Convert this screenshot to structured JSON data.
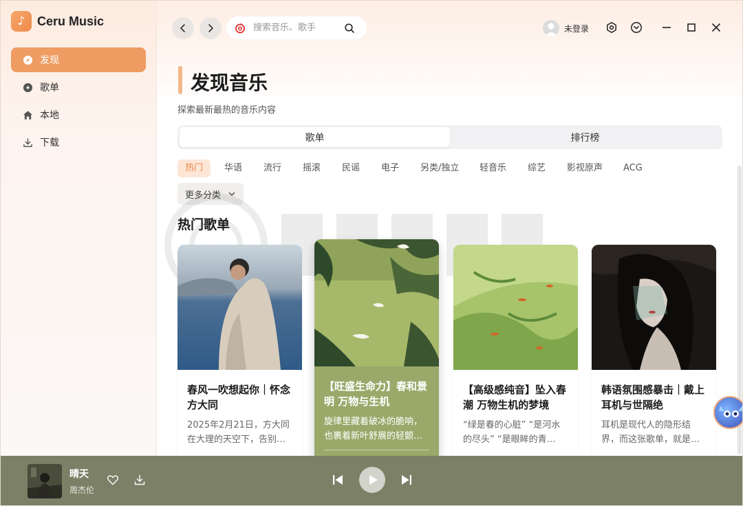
{
  "app": {
    "name": "Ceru Music",
    "logo_glyph": "♪"
  },
  "sidebar": {
    "items": [
      {
        "label": "发现",
        "icon": "compass-icon",
        "active": true
      },
      {
        "label": "歌单",
        "icon": "disc-icon",
        "active": false
      },
      {
        "label": "本地",
        "icon": "home-icon",
        "active": false
      },
      {
        "label": "下载",
        "icon": "download-icon",
        "active": false
      }
    ]
  },
  "topbar": {
    "search_placeholder": "搜索音乐、歌手",
    "user_label": "未登录"
  },
  "page": {
    "title": "发现音乐",
    "subtitle": "探索最新最热的音乐内容",
    "tabs": [
      {
        "label": "歌单",
        "active": true
      },
      {
        "label": "排行榜",
        "active": false
      }
    ],
    "categories": [
      {
        "label": "热门",
        "active": true
      },
      {
        "label": "华语"
      },
      {
        "label": "流行"
      },
      {
        "label": "摇滚"
      },
      {
        "label": "民谣"
      },
      {
        "label": "电子"
      },
      {
        "label": "另类/独立"
      },
      {
        "label": "轻音乐"
      },
      {
        "label": "综艺"
      },
      {
        "label": "影视原声"
      },
      {
        "label": "ACG"
      }
    ],
    "more_categories_label": "更多分类",
    "section_title": "热门歌单",
    "playlists": [
      {
        "title": "春风一吹想起你｜怀念方大同",
        "desc": "2025年2月21日，方大同在大理的天空下，告别…"
      },
      {
        "title": "【旺盛生命力】春和景明 万物与生机",
        "desc": "旋律里藏着破冰的脆响，也裹着新叶舒展的轻颤…"
      },
      {
        "title": "【高级感纯音】坠入春潮 万物生机的梦境",
        "desc": "“绿是春的心脏” “是河水的尽头” “是眼眸的青…"
      },
      {
        "title": "韩语氛围感暴击｜戴上耳机与世隔绝",
        "desc": "耳机是现代人的隐形结界，而这张歌单，就是…"
      }
    ]
  },
  "player": {
    "song": "晴天",
    "artist": "周杰伦"
  },
  "colors": {
    "accent": "#ee9c62",
    "player_bg": "#7b8067",
    "featured_card": "#9aa96a"
  }
}
